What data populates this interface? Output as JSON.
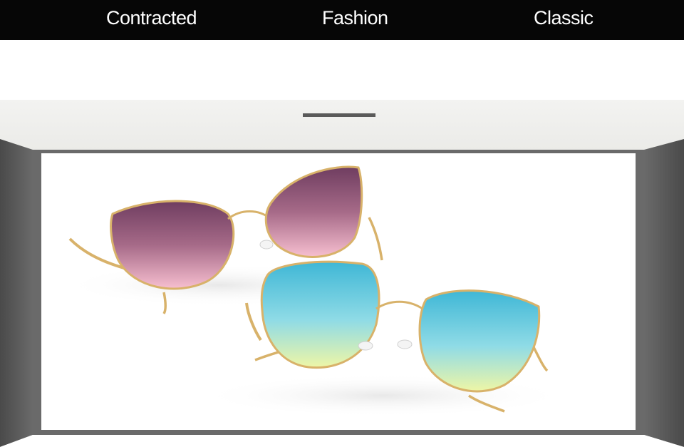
{
  "header": {
    "taglines": [
      "Contracted",
      "Fashion",
      "Classic"
    ]
  },
  "colors": {
    "header_bg": "#060606",
    "header_text": "#ffffff",
    "ceiling": "#efefed",
    "side_wall": "#5e5e5e",
    "back_frame": "#6a6a6a",
    "divider": "#5a5a5a",
    "frame_metal": "#d8b26a",
    "lens_top_pink": "#7a4a68",
    "lens_bottom_pink": "#f5b8cc",
    "lens_top_blue": "#48bcd8",
    "lens_bottom_blue": "#eaf4a8"
  },
  "product": {
    "image_subject": "sunglasses-photo"
  }
}
